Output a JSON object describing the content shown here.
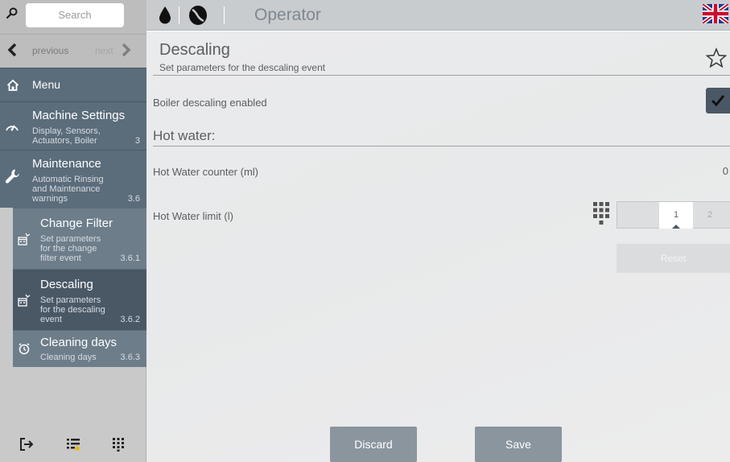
{
  "sidebar": {
    "search_placeholder": "Search",
    "nav": {
      "previous": "previous",
      "next": "next"
    },
    "menu_label": "Menu",
    "items": [
      {
        "title": "Machine Settings",
        "sub1": "Display, Sensors,",
        "sub2": "Actuators, Boiler",
        "num": "3"
      },
      {
        "title": "Maintenance",
        "sub1": "Automatic Rinsing",
        "sub2": "and Maintenance",
        "sub3": "warnings",
        "num": "3.6"
      }
    ],
    "subitems": [
      {
        "title": "Change Filter",
        "sub1": "Set parameters",
        "sub2": "for the change",
        "sub3": "filter event",
        "num": "3.6.1"
      },
      {
        "title": "Descaling",
        "sub1": "Set parameters",
        "sub2": "for the descaling",
        "sub3": "event",
        "num": "3.6.2"
      },
      {
        "title": "Cleaning days",
        "sub1": "Cleaning days",
        "num": "3.6.3"
      }
    ]
  },
  "header": {
    "title": "Operator"
  },
  "main": {
    "title": "Descaling",
    "subtitle": "Set parameters for the descaling event",
    "boiler_label": "Boiler descaling enabled",
    "section_title": "Hot water:",
    "counter_label": "Hot Water counter (ml)",
    "counter_value": "0",
    "limit_label": "Hot Water limit (l)",
    "limit_options": [
      "1",
      "2"
    ],
    "limit_selected": "1",
    "reset_label": "Reset",
    "discard_label": "Discard",
    "save_label": "Save"
  },
  "colors": {
    "accent": "#4a5866",
    "sidebar_active": "#5b6c7a",
    "button": "#8b959e"
  }
}
